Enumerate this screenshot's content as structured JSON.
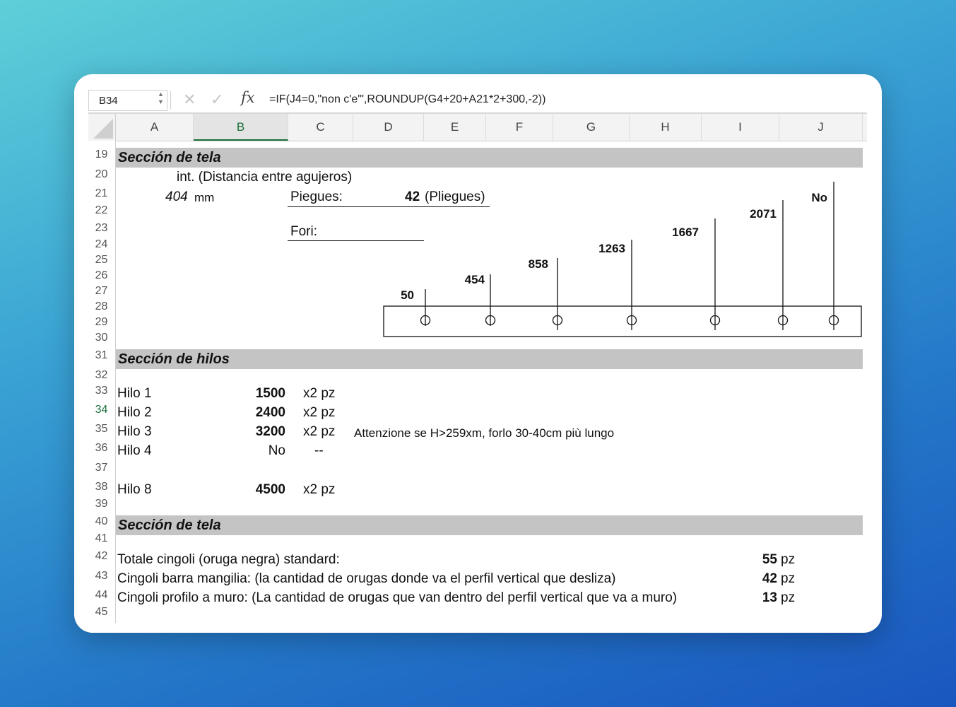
{
  "formula_bar": {
    "name_box": "B34",
    "formula": "=IF(J4=0,\"non c'e'\",ROUNDUP(G4+20+A21*2+300,-2))"
  },
  "columns": [
    "A",
    "B",
    "C",
    "D",
    "E",
    "F",
    "G",
    "H",
    "I",
    "J"
  ],
  "selected_column": "B",
  "rows": [
    "19",
    "20",
    "21",
    "22",
    "23",
    "24",
    "25",
    "26",
    "27",
    "28",
    "29",
    "30",
    "31",
    "32",
    "33",
    "34",
    "35",
    "36",
    "37",
    "38",
    "39",
    "40",
    "41",
    "42",
    "43",
    "44",
    "45"
  ],
  "selected_row": "34",
  "section_tela_1": {
    "title": "Sección de tela",
    "int_label": "int. (Distancia entre agujeros)",
    "value_404": "404",
    "unit_mm": "mm",
    "piegues_label": "Piegues:",
    "piegues_value": "42",
    "piegues_suffix": "(Pliegues)",
    "fori_label": "Fori:"
  },
  "hole_diagram": {
    "labels": [
      "50",
      "454",
      "858",
      "1263",
      "1667",
      "2071",
      "No"
    ]
  },
  "section_hilos": {
    "title": "Sección de hilos",
    "items": [
      {
        "name": "Hilo 1",
        "value": "1500",
        "qty": "x2 pz"
      },
      {
        "name": "Hilo 2",
        "value": "2400",
        "qty": "x2 pz"
      },
      {
        "name": "Hilo 3",
        "value": "3200",
        "qty": "x2 pz"
      },
      {
        "name": "Hilo 4",
        "value": "No",
        "qty": "--"
      },
      {
        "name": "Hilo 8",
        "value": "4500",
        "qty": "x2 pz"
      }
    ],
    "note": "Attenzione se H>259xm, forlo 30-40cm più lungo"
  },
  "section_tela_2": {
    "title": "Sección de tela",
    "lines": [
      {
        "label": "Totale cingoli (oruga negra) standard:",
        "value": "55",
        "unit": "pz"
      },
      {
        "label": "Cingoli barra mangilia: (la cantidad de orugas donde va el perfil vertical que desliza)",
        "value": "42",
        "unit": "pz"
      },
      {
        "label": "Cingoli profilo a muro: (La cantidad de orugas que van dentro del perfil vertical que va a muro)",
        "value": "13",
        "unit": "pz"
      }
    ]
  },
  "colors": {
    "band": "#c4c4c4",
    "selected": "#1a6e3a"
  }
}
